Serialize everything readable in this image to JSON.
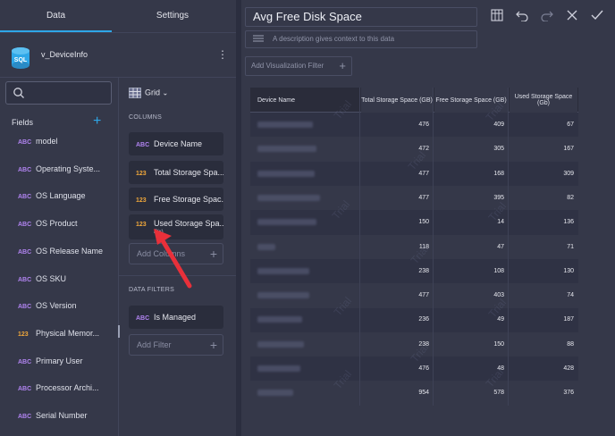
{
  "tabs": {
    "data": "Data",
    "settings": "Settings"
  },
  "datasource": {
    "icon_label": "SQL",
    "name": "v_DeviceInfo"
  },
  "fields_section": {
    "label": "Fields"
  },
  "fields": [
    {
      "type": "ABC",
      "name": "model"
    },
    {
      "type": "ABC",
      "name": "Operating Syste..."
    },
    {
      "type": "ABC",
      "name": "OS Language"
    },
    {
      "type": "ABC",
      "name": "OS Product"
    },
    {
      "type": "ABC",
      "name": "OS Release Name"
    },
    {
      "type": "ABC",
      "name": "OS SKU"
    },
    {
      "type": "ABC",
      "name": "OS Version"
    },
    {
      "type": "123",
      "name": "Physical Memor..."
    },
    {
      "type": "ABC",
      "name": "Primary User"
    },
    {
      "type": "ABC",
      "name": "Processor Archi..."
    },
    {
      "type": "ABC",
      "name": "Serial Number"
    }
  ],
  "viz_type": "Grid",
  "columns_label": "COLUMNS",
  "columns": [
    {
      "type": "ABC",
      "name": "Device Name"
    },
    {
      "type": "123",
      "name": "Total Storage Spa..."
    },
    {
      "type": "123",
      "name": "Free Storage Spac..."
    },
    {
      "type": "123",
      "name": "Used Storage Spa...",
      "sub": "F(x)"
    }
  ],
  "add_column": "Add Columns",
  "filters_label": "DATA FILTERS",
  "filters": [
    {
      "type": "ABC",
      "name": "Is Managed"
    }
  ],
  "add_filter": "Add Filter",
  "visualization": {
    "title": "Avg Free Disk Space",
    "description_placeholder": "A description gives context to this data",
    "add_filter": "Add Visualization Filter"
  },
  "table": {
    "headers": [
      "Device Name",
      "Total Storage Space (GB)",
      "Free Storage Space (GB)",
      "Used Storage Space (Gb)"
    ],
    "rows": [
      [
        476,
        409,
        67
      ],
      [
        472,
        305,
        167
      ],
      [
        477,
        168,
        309
      ],
      [
        477,
        395,
        82
      ],
      [
        150,
        14,
        136
      ],
      [
        118,
        47,
        71
      ],
      [
        238,
        108,
        130
      ],
      [
        477,
        403,
        74
      ],
      [
        236,
        49,
        187
      ],
      [
        238,
        150,
        88
      ],
      [
        476,
        48,
        428
      ],
      [
        954,
        578,
        376
      ]
    ]
  },
  "watermark": "Trial",
  "colors": {
    "accent": "#2ea7e8",
    "text_type": "#b083f0",
    "number_type": "#f2a93b",
    "arrow": "#e8303a"
  }
}
